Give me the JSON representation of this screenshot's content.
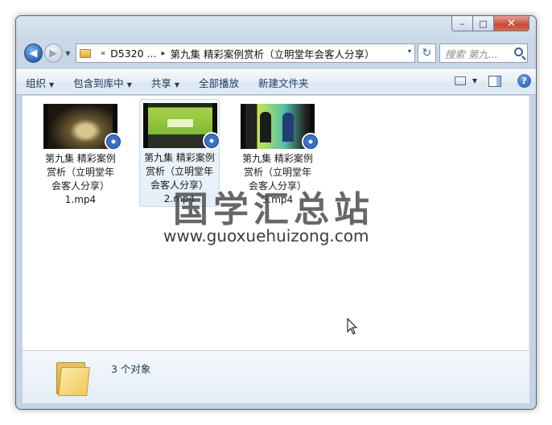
{
  "window": {
    "controls": {
      "minimize": "–",
      "maximize": "□",
      "close": "✕"
    }
  },
  "nav": {
    "back_icon": "back-arrow-icon",
    "forward_icon": "forward-arrow-icon",
    "address": {
      "chevron": "«",
      "crumb1": "D5320 ...",
      "crumb_sep": "▸",
      "crumb2": "第九集 精彩案例赏析（立明堂年会客人分享）",
      "dropdown": "▾"
    },
    "refresh_glyph": "↻",
    "search_placeholder": "搜索 第九..."
  },
  "toolbar": {
    "organize": "组织",
    "include_in_library": "包含到库中",
    "share": "共享",
    "play_all": "全部播放",
    "new_folder": "新建文件夹",
    "help": "?"
  },
  "files": [
    {
      "name": "第九集 精彩案例\n赏析（立明堂年\n会客人分享）\n1.mp4",
      "selected": false
    },
    {
      "name": "第九集 精彩案例\n赏析（立明堂年\n会客人分享）\n2.mp4",
      "selected": true
    },
    {
      "name": "第九集 精彩案例\n赏析（立明堂年\n会客人分享）\n3.mp4",
      "selected": false
    }
  ],
  "watermark": {
    "chinese": "国学汇总站",
    "url": "www.guoxuehuizong.com"
  },
  "details": {
    "count": "3 个对象"
  }
}
